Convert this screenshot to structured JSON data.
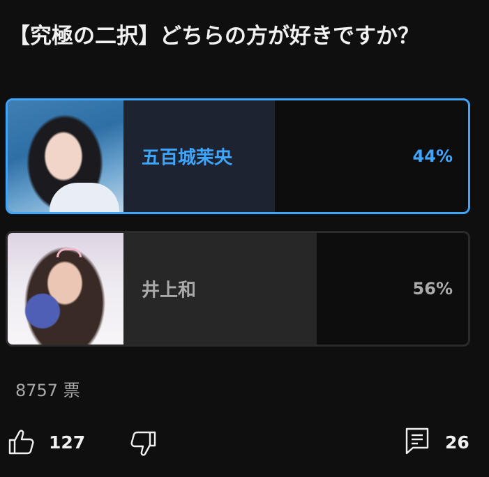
{
  "post": {
    "title": "【究極の二択】どちらの方が好きですか？"
  },
  "poll": {
    "options": [
      {
        "name": "五百城茉央",
        "percent": "44%",
        "fraction": 0.44,
        "selected": true
      },
      {
        "name": "井上和",
        "percent": "56%",
        "fraction": 0.56,
        "selected": false
      }
    ],
    "votes": "8757 票"
  },
  "actions": {
    "like_count": "127",
    "comment_count": "26",
    "like_icon": "thumbs-up-icon",
    "dislike_icon": "thumbs-down-icon",
    "comment_icon": "comment-icon"
  },
  "colors": {
    "background": "#0f0f0f",
    "accent": "#3ea6ff",
    "muted": "#aaaaaa"
  }
}
